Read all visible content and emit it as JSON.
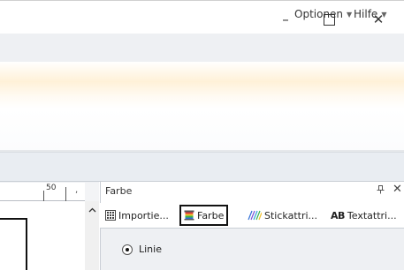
{
  "window": {
    "minimize_glyph": "–",
    "close_glyph": "✕"
  },
  "menu": {
    "optionen": "Optionen",
    "hilfe": "Hilfe"
  },
  "ruler": {
    "label": "50",
    "mark": ","
  },
  "panel": {
    "title": "Farbe",
    "pin_glyph": "⊥",
    "close_glyph": "✕",
    "tabs": [
      {
        "label": "Importie...",
        "icon": "import-grid-icon"
      },
      {
        "label": "Farbe",
        "icon": "color-spool-icon"
      },
      {
        "label": "Stickattri...",
        "icon": "stitch-attributes-icon"
      },
      {
        "label": "Textattri...",
        "icon": "text-attributes-icon",
        "prefix": "AB"
      }
    ],
    "selected_tab": "Farbe",
    "radio": {
      "label": "Linie",
      "checked": true
    }
  },
  "colors": {
    "accent_tab_border": "#111111",
    "ribbon_highlight": "#fff1d8"
  }
}
